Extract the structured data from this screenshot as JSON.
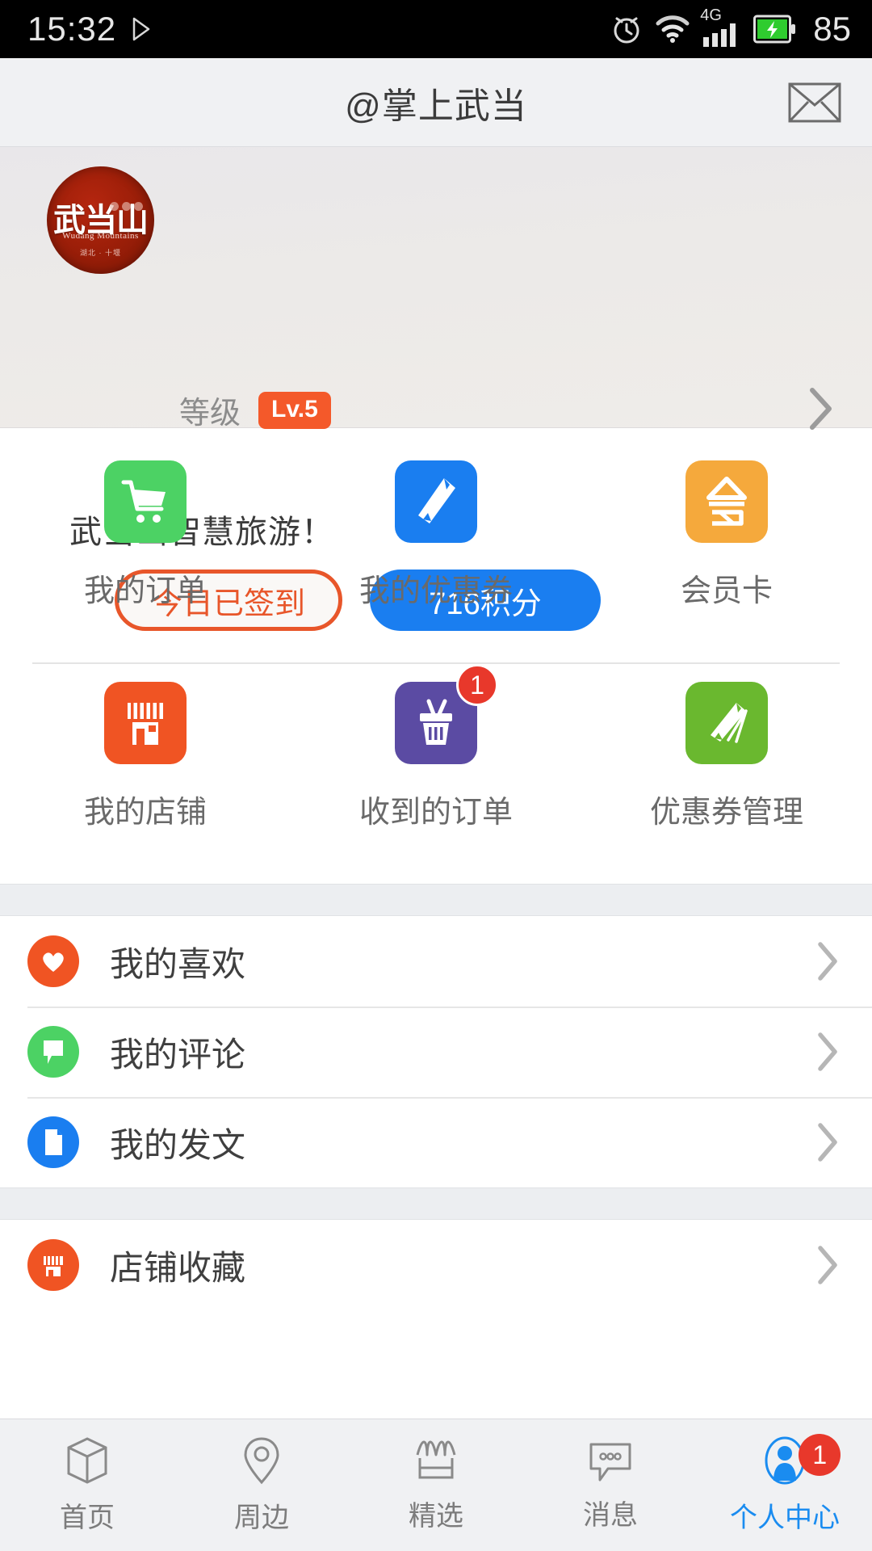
{
  "statusbar": {
    "time": "15:32",
    "play_icon": "play-icon",
    "alarm_icon": "alarm-icon",
    "wifi_icon": "wifi-icon",
    "network_label": "4G",
    "signal_icon": "signal-bars-icon",
    "battery_icon": "battery-charging-icon",
    "battery_level": "85"
  },
  "header": {
    "title": "@掌上武当",
    "mail_icon": "mail-icon"
  },
  "profile": {
    "avatar_main_text": "武当山",
    "avatar_sub_text": "Wudang Mountains",
    "avatar_sub2_text": "湖北 · 十堰",
    "level_label": "等级",
    "level_value": "Lv.5",
    "chevron_icon": "chevron-right-icon",
    "slogan": "武当山智慧旅游！",
    "signin_button": "今日已签到",
    "points_button": "716积分",
    "accent_orange": "#e8562a",
    "accent_blue": "#1a7ef0",
    "level_badge_color": "#f4592a"
  },
  "grid": {
    "rows": [
      [
        {
          "label": "我的订单",
          "icon": "shopping-cart-icon",
          "color": "#4cd264",
          "badge": ""
        },
        {
          "label": "我的优惠券",
          "icon": "coupon-ticket-icon",
          "color": "#1a7ef0",
          "badge": ""
        },
        {
          "label": "会员卡",
          "icon": "membership-card-icon",
          "color": "#f5a93c",
          "badge": ""
        }
      ],
      [
        {
          "label": "我的店铺",
          "icon": "shop-icon",
          "color": "#f05423",
          "badge": ""
        },
        {
          "label": "收到的订单",
          "icon": "basket-icon",
          "color": "#5b4ba3",
          "badge": "1"
        },
        {
          "label": "优惠券管理",
          "icon": "coupon-stack-icon",
          "color": "#6ab82f",
          "badge": ""
        }
      ]
    ]
  },
  "list_groups": [
    {
      "rows": [
        {
          "label": "我的喜欢",
          "icon": "heart-icon",
          "color": "#f05423",
          "chevron": "chevron-right-icon"
        },
        {
          "label": "我的评论",
          "icon": "comment-icon",
          "color": "#4cd264",
          "chevron": "chevron-right-icon"
        },
        {
          "label": "我的发文",
          "icon": "document-icon",
          "color": "#1a7ef0",
          "chevron": "chevron-right-icon"
        }
      ]
    },
    {
      "rows": [
        {
          "label": "店铺收藏",
          "icon": "shop-favorite-icon",
          "color": "#f05423",
          "chevron": "chevron-right-icon"
        }
      ]
    }
  ],
  "tabbar": {
    "items": [
      {
        "label": "首页",
        "icon": "cube-icon",
        "active": false,
        "badge": ""
      },
      {
        "label": "周边",
        "icon": "location-pin-icon",
        "active": false,
        "badge": ""
      },
      {
        "label": "精选",
        "icon": "storefront-icon",
        "active": false,
        "badge": ""
      },
      {
        "label": "消息",
        "icon": "chat-bubble-icon",
        "active": false,
        "badge": ""
      },
      {
        "label": "个人中心",
        "icon": "person-icon",
        "active": true,
        "badge": "1"
      }
    ],
    "active_color": "#1a8cf0",
    "inactive_color": "#7c7c7c"
  }
}
